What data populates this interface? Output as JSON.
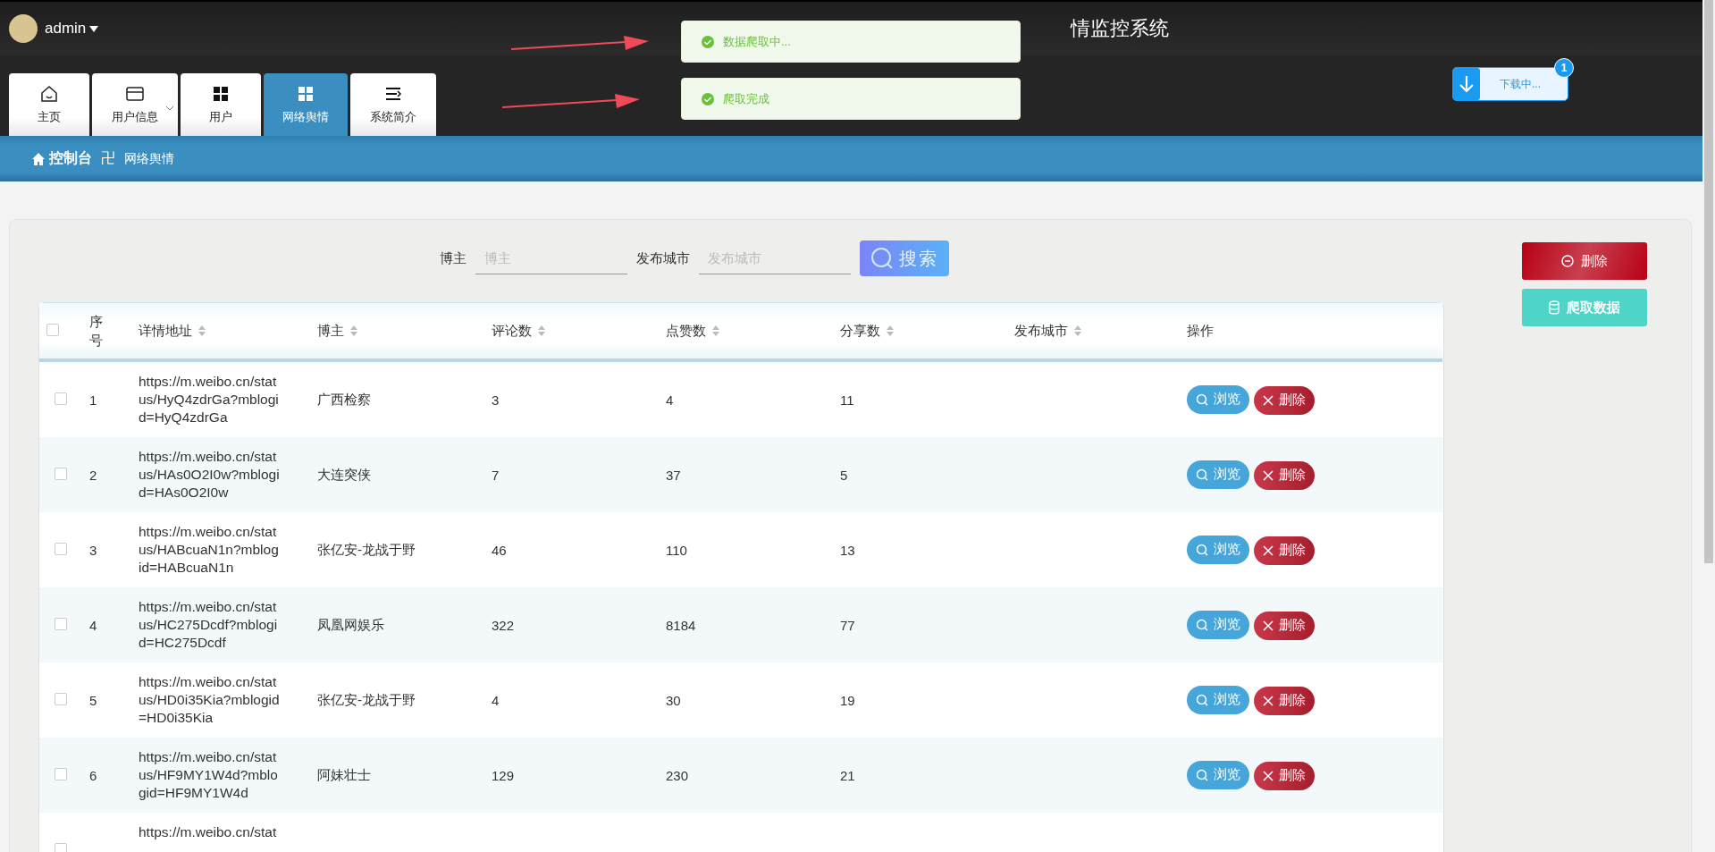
{
  "header": {
    "user": "admin",
    "title": "情监控系统"
  },
  "tabs": [
    {
      "label": "主页",
      "selected": false,
      "has_menu": false
    },
    {
      "label": "用户信息",
      "selected": false,
      "has_menu": true
    },
    {
      "label": "用户",
      "selected": false,
      "has_menu": false
    },
    {
      "label": "网络舆情",
      "selected": true,
      "has_menu": false
    },
    {
      "label": "系统简介",
      "selected": false,
      "has_menu": false
    }
  ],
  "download": {
    "label": "下载中...",
    "badge": "1"
  },
  "toasts": [
    {
      "text": "数据爬取中..."
    },
    {
      "text": "爬取完成"
    }
  ],
  "breadcrumb": {
    "root": "控制台",
    "separator": "卍",
    "current": "网络舆情"
  },
  "search": {
    "fields": [
      {
        "label": "博主",
        "placeholder": "博主"
      },
      {
        "label": "发布城市",
        "placeholder": "发布城市"
      }
    ],
    "button": "搜索"
  },
  "actions": [
    {
      "label": "删除",
      "kind": "delete"
    },
    {
      "label": "爬取数据",
      "kind": "crawl"
    }
  ],
  "table": {
    "select_all": {
      "checked": false
    },
    "columns": [
      {
        "label": "序号",
        "sortable": false
      },
      {
        "label": "详情地址",
        "sortable": true
      },
      {
        "label": "博主",
        "sortable": true
      },
      {
        "label": "评论数",
        "sortable": true
      },
      {
        "label": "点赞数",
        "sortable": true
      },
      {
        "label": "分享数",
        "sortable": true
      },
      {
        "label": "发布城市",
        "sortable": true
      },
      {
        "label": "操作",
        "sortable": false
      }
    ],
    "rows": [
      {
        "checked": false,
        "index": "1",
        "url": "https://m.weibo.cn/status/HyQ4zdrGa?mblogid=HyQ4zdrGa",
        "author": "广西检察",
        "comments": "3",
        "likes": "4",
        "shares": "11",
        "view": "浏览",
        "delete": "删除"
      },
      {
        "checked": false,
        "index": "2",
        "url": "https://m.weibo.cn/status/HAs0O2I0w?mblogid=HAs0O2I0w",
        "author": "大连突侠",
        "comments": "7",
        "likes": "37",
        "shares": "5",
        "view": "浏览",
        "delete": "删除"
      },
      {
        "checked": false,
        "index": "3",
        "url": "https://m.weibo.cn/status/HABcuaN1n?mblogid=HABcuaN1n",
        "author": "张亿安-龙战于野",
        "comments": "46",
        "likes": "110",
        "shares": "13",
        "view": "浏览",
        "delete": "删除"
      },
      {
        "checked": false,
        "index": "4",
        "url": "https://m.weibo.cn/status/HC275Dcdf?mblogid=HC275Dcdf",
        "author": "凤凰网娱乐",
        "comments": "322",
        "likes": "8184",
        "shares": "77",
        "view": "浏览",
        "delete": "删除"
      },
      {
        "checked": false,
        "index": "5",
        "url": "https://m.weibo.cn/status/HD0i35Kia?mblogid=HD0i35Kia",
        "author": "张亿安-龙战于野",
        "comments": "4",
        "likes": "30",
        "shares": "19",
        "view": "浏览",
        "delete": "删除"
      },
      {
        "checked": false,
        "index": "6",
        "url": "https://m.weibo.cn/status/HF9MY1W4d?mblogid=HF9MY1W4d",
        "author": "阿妹壮士",
        "comments": "129",
        "likes": "230",
        "shares": "21",
        "view": "浏览",
        "delete": "删除"
      },
      {
        "checked": false,
        "url": "https://m.weibo.cn/stat"
      }
    ]
  }
}
